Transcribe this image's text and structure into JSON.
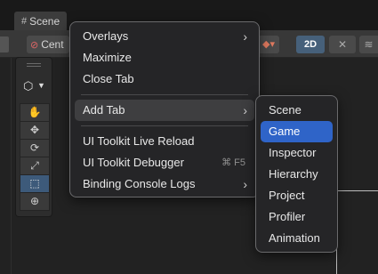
{
  "tab": {
    "label": "Scene",
    "icon": "grid-icon"
  },
  "toolbar": {
    "pivot_label": "Cent",
    "mode_2d_label": "2D"
  },
  "tools": [
    {
      "name": "hand-tool",
      "glyph": "✋"
    },
    {
      "name": "move-tool",
      "glyph": "✥"
    },
    {
      "name": "rotate-tool",
      "glyph": "⟳"
    },
    {
      "name": "scale-tool",
      "glyph": "⤢"
    },
    {
      "name": "rect-tool",
      "glyph": "⬚"
    },
    {
      "name": "transform-tool",
      "glyph": "⊕"
    }
  ],
  "context_menu": {
    "items": [
      {
        "label": "Overlays",
        "has_submenu": true,
        "shortcut": ""
      },
      {
        "label": "Maximize",
        "has_submenu": false,
        "shortcut": ""
      },
      {
        "label": "Close Tab",
        "has_submenu": false,
        "shortcut": ""
      },
      {
        "label": "Add Tab",
        "has_submenu": true,
        "shortcut": "",
        "highlighted": true
      },
      {
        "label": "UI Toolkit Live Reload",
        "has_submenu": false,
        "shortcut": ""
      },
      {
        "label": "UI Toolkit Debugger",
        "has_submenu": false,
        "shortcut": "⌘ F5"
      },
      {
        "label": "Binding Console Logs",
        "has_submenu": true,
        "shortcut": ""
      }
    ]
  },
  "add_tab_submenu": {
    "items": [
      "Scene",
      "Game",
      "Inspector",
      "Hierarchy",
      "Project",
      "Profiler",
      "Animation"
    ],
    "selected": "Game"
  },
  "colors": {
    "accent": "#2f64c8",
    "menu_bg": "#252527",
    "active_tool": "#3d5a7a"
  }
}
